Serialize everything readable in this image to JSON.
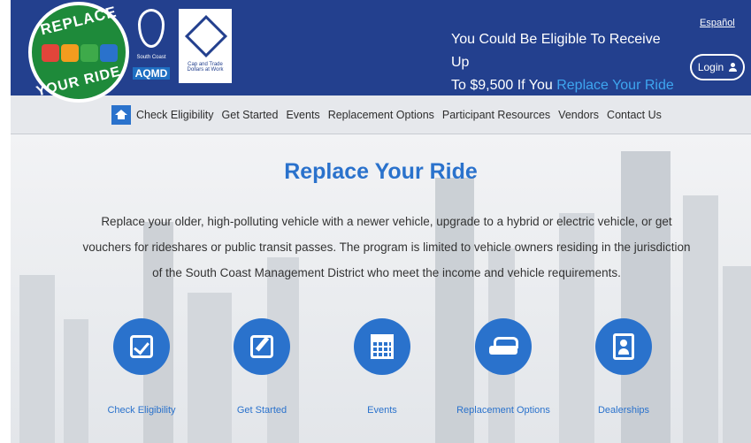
{
  "logo": {
    "top_text": "REPLACE",
    "bottom_text": "YOUR RIDE"
  },
  "partners": {
    "aqmd_small": "South Coast",
    "aqmd_big": "AQMD",
    "cci_text": "Cap and Trade Dollars at Work"
  },
  "header": {
    "promo_line1": "You Could Be Eligible To Receive Up",
    "promo_line2_prefix": "To $9,500 If You ",
    "promo_highlight": "Replace Your Ride",
    "language_link": "Español",
    "login_label": "Login"
  },
  "nav": {
    "items": [
      "Check Eligibility",
      "Get Started",
      "Events",
      "Replacement Options",
      "Participant Resources",
      "Vendors",
      "Contact Us"
    ]
  },
  "hero": {
    "title": "Replace Your Ride",
    "description": "Replace your older, high-polluting vehicle with a newer vehicle, upgrade to a hybrid or electric vehicle, or get vouchers for rideshares or public transit passes. The program is limited to vehicle owners residing in the jurisdiction of the South Coast Management District who meet the income and vehicle requirements."
  },
  "tiles": [
    {
      "label": "Check Eligibility",
      "icon": "check-square-icon"
    },
    {
      "label": "Get Started",
      "icon": "edit-icon"
    },
    {
      "label": "Events",
      "icon": "calendar-icon"
    },
    {
      "label": "Replacement Options",
      "icon": "car-icon"
    },
    {
      "label": "Dealerships",
      "icon": "address-book-icon"
    }
  ],
  "colors": {
    "header_bg": "#23408e",
    "accent": "#2a72cc",
    "highlight": "#3ea6f0",
    "logo_green": "#1e8a3a"
  }
}
